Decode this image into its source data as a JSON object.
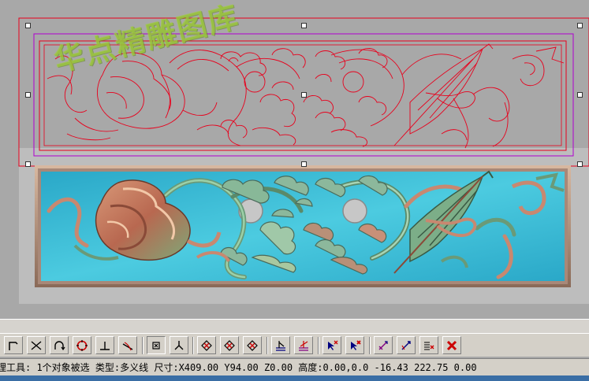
{
  "watermark": {
    "text": "华点精雕图库"
  },
  "toolbar": {
    "buttons": [
      {
        "icon": "polyline-corner-icon",
        "color": "#000000"
      },
      {
        "icon": "line-intersect-icon",
        "color": "#000000"
      },
      {
        "icon": "arc-icon",
        "color": "#000000"
      },
      {
        "icon": "circle-target-icon",
        "color": "#cc0000"
      },
      {
        "icon": "perpendicular-icon",
        "color": "#000000"
      },
      {
        "icon": "tangent-icon",
        "color": "#000000"
      },
      {
        "icon": "point-snap-icon",
        "color": "#000000"
      },
      {
        "icon": "node-split-icon",
        "color": "#000000"
      },
      {
        "icon": "diamond-x-icon",
        "color": "#cc0000"
      },
      {
        "icon": "diamond-x-2-icon",
        "color": "#cc0000"
      },
      {
        "icon": "diamond-x-3-icon",
        "color": "#cc0000"
      },
      {
        "icon": "baseline-align-icon",
        "color": "#000080"
      },
      {
        "icon": "baseline-align-2-icon",
        "color": "#800080"
      },
      {
        "icon": "cursor-x-icon",
        "color": "#000080"
      },
      {
        "icon": "cursor-x-red-icon",
        "color": "#cc0000"
      },
      {
        "icon": "measure-arrow-icon",
        "color": "#800080"
      },
      {
        "icon": "measure-arrow-2-icon",
        "color": "#000080"
      },
      {
        "icon": "list-x-icon",
        "color": "#000000"
      },
      {
        "icon": "delete-x-icon",
        "color": "#cc0000"
      }
    ]
  },
  "status": {
    "text": "理工具: 1个对象被选 类型:多义线 尺寸:X409.00 Y94.00 Z0.00 高度:0.00,0.0 -16.43 222.75 0.00"
  },
  "colors": {
    "selection_red": "#e8001c",
    "selection_purple": "#b000d0",
    "relief_blue": "#3ec0d8",
    "relief_clay": "#c07860",
    "relief_green": "#7aa870"
  }
}
